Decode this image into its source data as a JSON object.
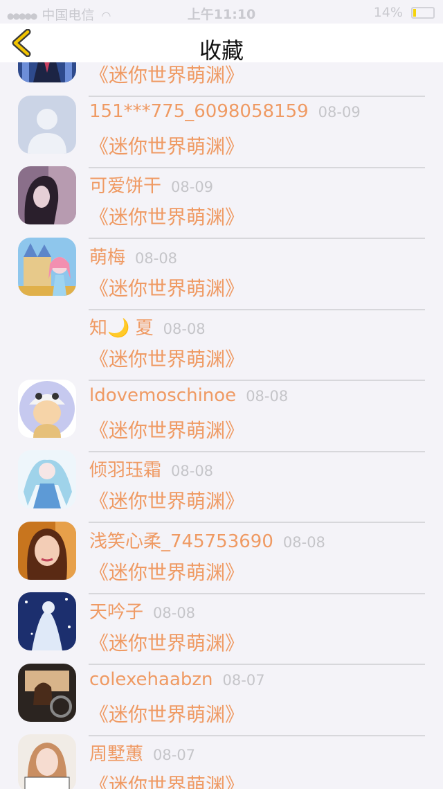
{
  "status": {
    "carrier": "中国电信",
    "time": "上午11:10",
    "battery": "14%"
  },
  "nav": {
    "title": "收藏"
  },
  "items": [
    {
      "name": "",
      "date": "",
      "title": "《迷你世界萌渊》",
      "avatar": "anime-girl-blue-avatar"
    },
    {
      "name": "151***775_6098058159",
      "date": "08-09",
      "title": "《迷你世界萌渊》",
      "avatar": "default-person-avatar"
    },
    {
      "name": "可爱饼干",
      "date": "08-09",
      "title": "《迷你世界萌渊》",
      "avatar": "dark-hair-girl-avatar"
    },
    {
      "name": "萌梅",
      "date": "08-08",
      "title": "《迷你世界萌渊》",
      "avatar": "castle-girl-avatar"
    },
    {
      "name": "知🌙 夏",
      "date": "08-08",
      "title": "《迷你世界萌渊》",
      "avatar": "none"
    },
    {
      "name": "ldovemoschinoe",
      "date": "08-08",
      "title": "《迷你世界萌渊》",
      "avatar": "cartoon-child-avatar"
    },
    {
      "name": "倾羽珏霜",
      "date": "08-08",
      "title": "《迷你世界萌渊》",
      "avatar": "blue-dress-girl-avatar"
    },
    {
      "name": "浅笑心柔_745753690",
      "date": "08-08",
      "title": "《迷你世界萌渊》",
      "avatar": "woman-photo-avatar"
    },
    {
      "name": "天吟子",
      "date": "08-08",
      "title": "《迷你世界萌渊》",
      "avatar": "starry-angel-avatar"
    },
    {
      "name": "colexehaabzn",
      "date": "08-07",
      "title": "《迷你世界萌渊》",
      "avatar": "car-driver-avatar"
    },
    {
      "name": "周墅蕙",
      "date": "08-07",
      "title": "《迷你世界萌渊》",
      "avatar": "girl-with-sign-avatar"
    }
  ],
  "colors": {
    "accent": "#ef9a63",
    "date": "#c5c5c9",
    "divider": "#d7d7db",
    "back_arrow": "#f2c400"
  }
}
